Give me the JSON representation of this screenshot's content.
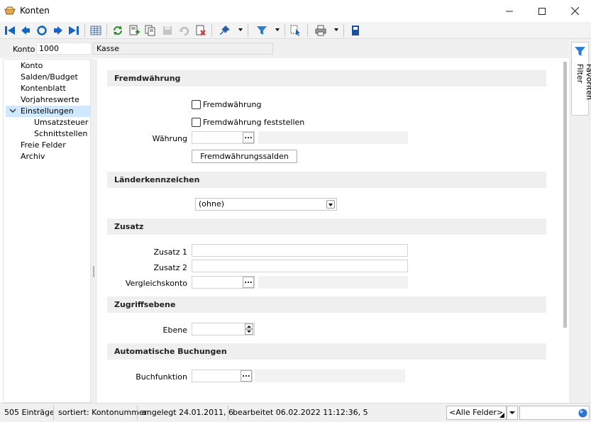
{
  "window": {
    "title": "Konten",
    "minimize": "—",
    "maximize": "☐",
    "close": "✕"
  },
  "toolbar": {
    "icons": [
      "first-record-icon",
      "previous-record-icon",
      "refresh-record-icon",
      "next-record-icon",
      "last-record-icon",
      "table-view-icon",
      "reload-icon",
      "new-record-icon",
      "copy-record-icon",
      "save-icon",
      "undo-icon",
      "delete-icon",
      "pin-icon",
      "filter-icon",
      "select-icon",
      "print-icon",
      "save-layout-icon"
    ]
  },
  "account": {
    "label": "Konto",
    "number": "1000",
    "name": "Kasse"
  },
  "tree": {
    "items": [
      {
        "label": "Konto"
      },
      {
        "label": "Salden/Budget"
      },
      {
        "label": "Kontenblatt"
      },
      {
        "label": "Vorjahreswerte"
      },
      {
        "label": "Einstellungen"
      },
      {
        "label": "Umsatzsteuer"
      },
      {
        "label": "Schnittstellen"
      },
      {
        "label": "Freie Felder"
      },
      {
        "label": "Archiv"
      }
    ],
    "selected": "Einstellungen"
  },
  "form": {
    "fremdwaehrung": {
      "header": "Fremdwährung",
      "cb1": "Fremdwährung",
      "cb2": "Fremdwährung feststellen",
      "waehrung_label": "Währung",
      "waehrung_value": "",
      "salden_button": "Fremdwährungssalden",
      "ellipsis": "..."
    },
    "laender": {
      "header": "Länderkennzeichen",
      "selected": "(ohne)"
    },
    "zusatz": {
      "header": "Zusatz",
      "z1_label": "Zusatz 1",
      "z2_label": "Zusatz 2",
      "vk_label": "Vergleichskonto",
      "ellipsis": "..."
    },
    "zugriff": {
      "header": "Zugriffsebene",
      "ebene_label": "Ebene"
    },
    "auto": {
      "header": "Automatische Buchungen",
      "buch_label": "Buchfunktion",
      "ellipsis": "..."
    }
  },
  "sidebar": {
    "favorites_tab": "Favoriten Filter"
  },
  "status": {
    "count": "505 Einträge",
    "sort": "sortiert: Kontonummer",
    "created": "angelegt 24.01.2011,  6",
    "edited": "bearbeitet 06.02.2022 11:12:36,  5",
    "field_filter": "<Alle Felder>",
    "search_value": ""
  },
  "colors": {
    "accent_blue": "#1565c0",
    "selection": "#cde8ff",
    "section_bg": "#efefef"
  }
}
